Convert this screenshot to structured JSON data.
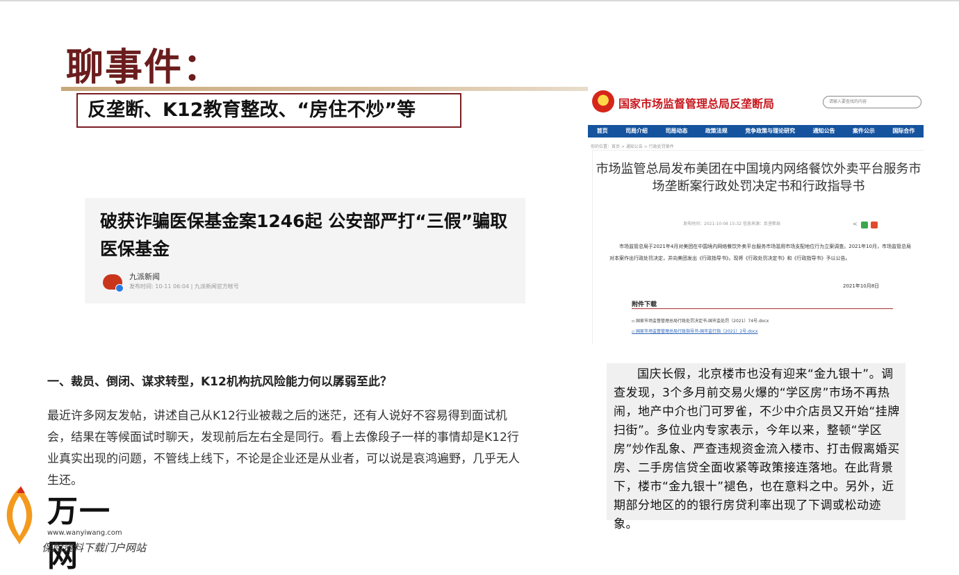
{
  "slide": {
    "title": "聊事件：",
    "subtitle": "反垄断、K12教育整改、“房住不炒”等"
  },
  "news_card": {
    "headline": "破获诈骗医保基金案1246起 公安部严打“三假”骗取医保基金",
    "source": "九派新闻",
    "meta": "发布时间: 10-11 06:04 | 九派新闻官方帐号"
  },
  "k12_article": {
    "heading": "一、裁员、倒闭、谋求转型，K12机构抗风险能力何以孱弱至此？",
    "body": "最近许多网友发帖，讲述自己从K12行业被裁之后的迷茫，还有人说好不容易得到面试机会，结果在等候面试时聊天，发现前后左右全是同行。看上去像段子一样的事情却是K12行业真实出现的问题，不管线上线下，不论是企业还是从业者，可以说是哀鸿遍野，几乎无人生还。"
  },
  "gov_site": {
    "site_name": "国家市场监督管理总局反垄断局",
    "search_placeholder": "请输入要查找的内容",
    "nav": [
      "首页",
      "司局介绍",
      "司局动态",
      "政策法规",
      "竞争政策与理论研究",
      "通知公告",
      "案件公示",
      "国际合作"
    ],
    "breadcrumb": "你的位置：首页 > 通知公告 > 行政处罚案件",
    "article_title": "市场监管总局发布美团在中国境内网络餐饮外卖平台服务市场垄断案行政处罚决定书和行政指导书",
    "date_line": "发布时间：2021-10-08 15:32    信息来源：反垄断局",
    "lead": "市场监管总局于2021年4月对美团在中国境内网络餐饮外卖平台服务市场滥用市场支配地位行为立案调查。2021年10月，市场监管总局对本案作出行政处罚决定，并向美团发出《行政指导书》。现将《行政处罚决定书》和《行政指导书》予以公告。",
    "signature_date": "2021年10月8日",
    "attachments_heading": "附件下载",
    "attachments": [
      "国家市场监督管理总局行政处罚决定书-国市监处罚〔2021〕74号.docx",
      "国家市场监督管理总局行政指导书-国市监行指〔2021〕2号.docx"
    ]
  },
  "housing_passage": {
    "text": "国庆长假，北京楼市也没有迎来“金九银十”。调查发现，3个多月前交易火爆的“学区房”市场不再热闹，地产中介也门可罗雀，不少中介店员又开始“挂牌扫街”。多位业内专家表示，今年以来，整顿“学区房”炒作乱象、严查违规资金流入楼市、打击假离婚买房、二手房信贷全面收紧等政策接连落地。在此背景下，楼市“金九银十”褪色，也在意料之中。另外，近期部分地区的的银行房贷利率出现了下调或松动迹象。"
  },
  "watermark": {
    "brand": "万一网",
    "url": "www.wanyiwang.com",
    "slogan": "保险资料下载门户网站"
  },
  "colors": {
    "title": "#6b1d1e",
    "subtitle_border": "#7a1d22",
    "gov_red": "#c8181e",
    "gov_nav": "#15539e"
  }
}
